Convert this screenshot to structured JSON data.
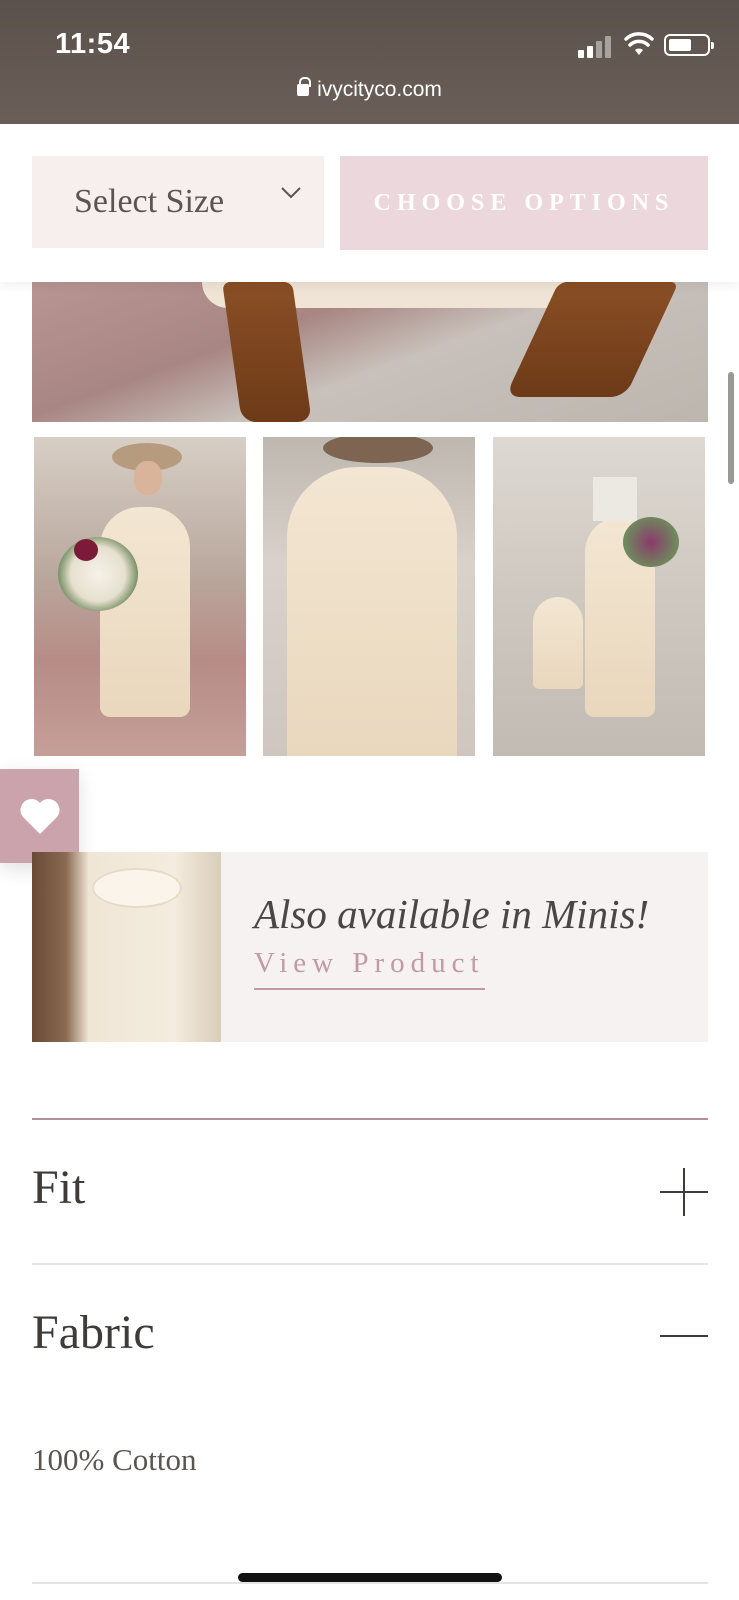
{
  "status_bar": {
    "time": "11:54",
    "url": "ivycityco.com"
  },
  "options": {
    "size_select_label": "Select Size",
    "choose_button_label": "CHOOSE OPTIONS"
  },
  "minis_banner": {
    "text": "Also available in Minis!",
    "link_label": "View Product"
  },
  "accordions": [
    {
      "title": "Fit",
      "state": "collapsed",
      "icon": "plus-icon"
    },
    {
      "title": "Fabric",
      "state": "expanded",
      "icon": "minus-icon",
      "body": "100% Cotton"
    }
  ],
  "colors": {
    "accent_pink": "#ecd7dc",
    "link_pink": "#c19aa4",
    "wishlist_tab": "#cba3ad",
    "select_bg": "#f7efee"
  }
}
